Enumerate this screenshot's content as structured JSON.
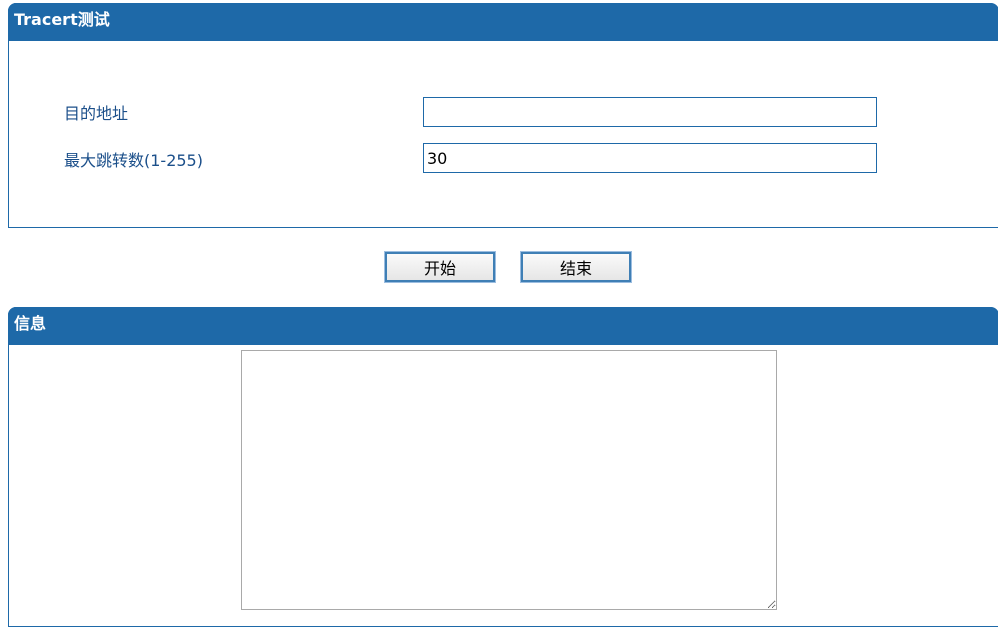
{
  "tracert_panel": {
    "title": "Tracert测试",
    "destination": {
      "label": "目的地址",
      "value": ""
    },
    "max_hops": {
      "label": "最大跳转数(1-255)",
      "value": "30"
    }
  },
  "buttons": {
    "start_label": "开始",
    "stop_label": "结束"
  },
  "info_panel": {
    "title": "信息",
    "content": ""
  },
  "colors": {
    "header_bg": "#1e69a8",
    "label_text": "#1b4f8a",
    "border": "#1e69a8"
  }
}
